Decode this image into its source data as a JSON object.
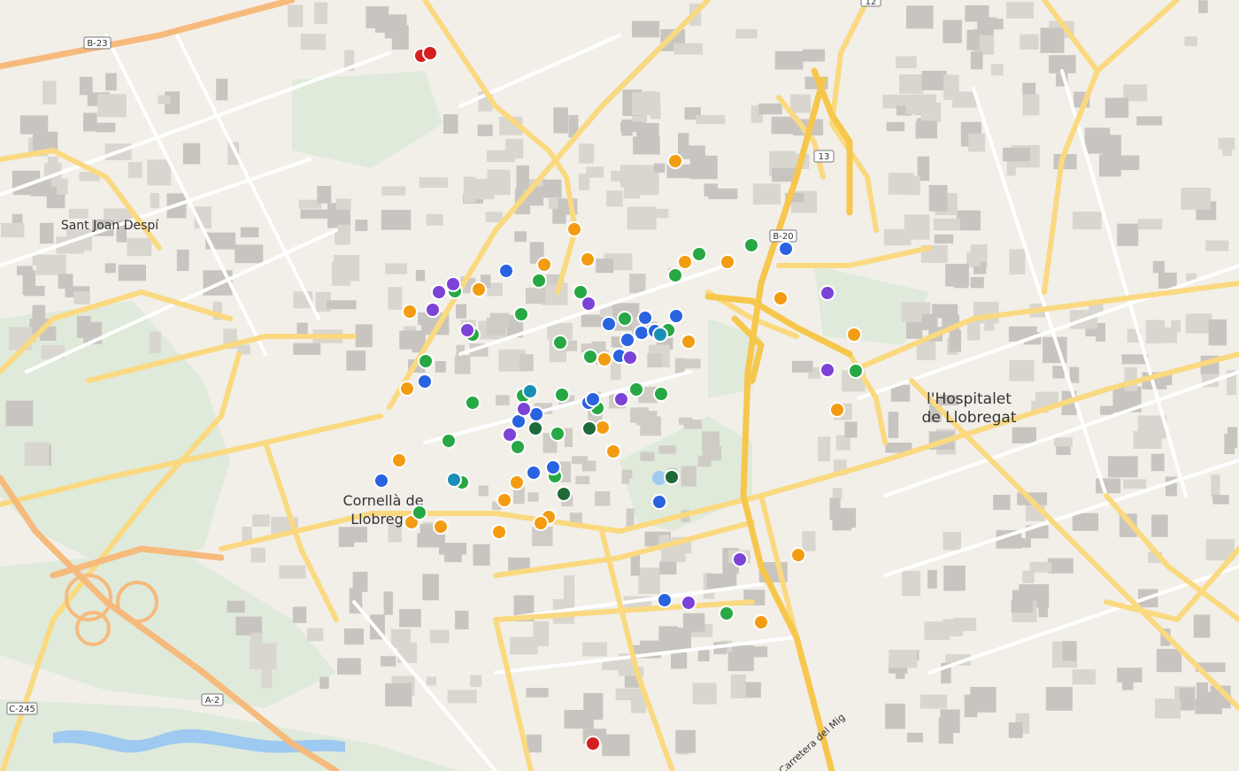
{
  "map": {
    "colors": {
      "background": "#f2efe9",
      "block": "#d9d6d0",
      "building": "#c8c5c0",
      "park": "#dfeadb",
      "water": "#9ec9f0",
      "motorway": "#f6ba7c",
      "arterial": "#fad980",
      "street": "#ffffff"
    },
    "labels": {
      "sant_joan": "Sant Joan Despí",
      "cornella_1": "Cornellà de",
      "cornella_2": "Llobreg",
      "hospitalet_1": "l'Hospitalet",
      "hospitalet_2": "de Llobregat",
      "carretera": "Carretera del Mig"
    },
    "shields": {
      "b23": "B-23",
      "b20": "B-20",
      "r13": "13",
      "r12": "12",
      "c245": "C-245",
      "a2": "A-2"
    },
    "marker_colors": {
      "orange": "#f39c12",
      "green": "#27a844",
      "dark_green": "#1e6a38",
      "blue": "#2a63e0",
      "teal": "#1a8fb5",
      "purple": "#7c43d6",
      "red": "#d42020"
    }
  }
}
